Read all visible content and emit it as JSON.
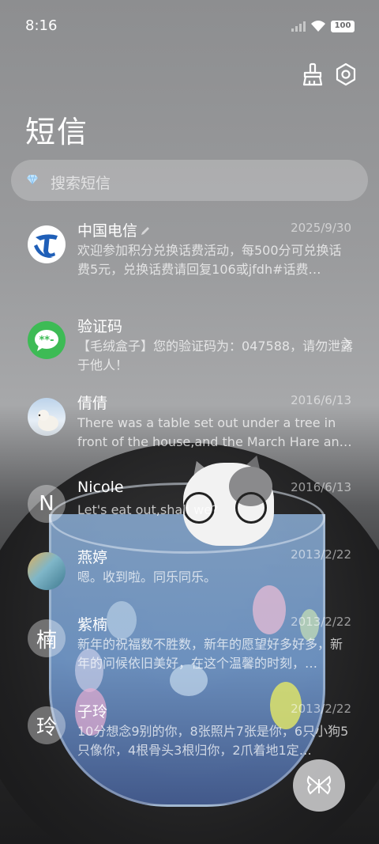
{
  "status_bar": {
    "time": "8:16",
    "battery": "100"
  },
  "header": {
    "title": "短信"
  },
  "search": {
    "placeholder": "搜索短信"
  },
  "conversations": [
    {
      "name": "中国电信",
      "date": "2025/9/30",
      "preview": "欢迎参加积分兑换话费活动，每500分可兑换话费5元，兑换话费请回复106或jfdh#话费…",
      "avatar": "china-telecom-logo"
    },
    {
      "name": "验证码",
      "date": "",
      "preview": "【毛绒盒子】您的验证码为：047588，请勿泄露于他人！",
      "avatar": "sms-bubble-icon"
    },
    {
      "name": "倩倩",
      "date": "2016/6/13",
      "preview": "There was a table set out under a tree in front of the house,and the March Hare an…",
      "avatar": "polar-bear-photo"
    },
    {
      "name": "Nicole",
      "date": "2016/6/13",
      "preview": "Let's eat out,shall we?",
      "avatar_letter": "N"
    },
    {
      "name": "燕婷",
      "date": "2013/2/22",
      "preview": "嗯。收到啦。同乐同乐。",
      "avatar": "landscape-photo"
    },
    {
      "name": "紫楠",
      "date": "2013/2/22",
      "preview": "新年的祝福数不胜数，新年的愿望好多好多，新年的问候依旧美好，在这个温馨的时刻，…",
      "avatar_letter": "楠"
    },
    {
      "name": "子玲",
      "date": "2013/2/22",
      "preview": "10分想念9别的你，8张照片7张是你，6只小狗5只像你，4根骨头3根归你，2爪着地1定…",
      "avatar_letter": "玲"
    }
  ],
  "colors": {
    "telecom_blue": "#1f5fb8",
    "sms_green": "#3dbb55"
  }
}
